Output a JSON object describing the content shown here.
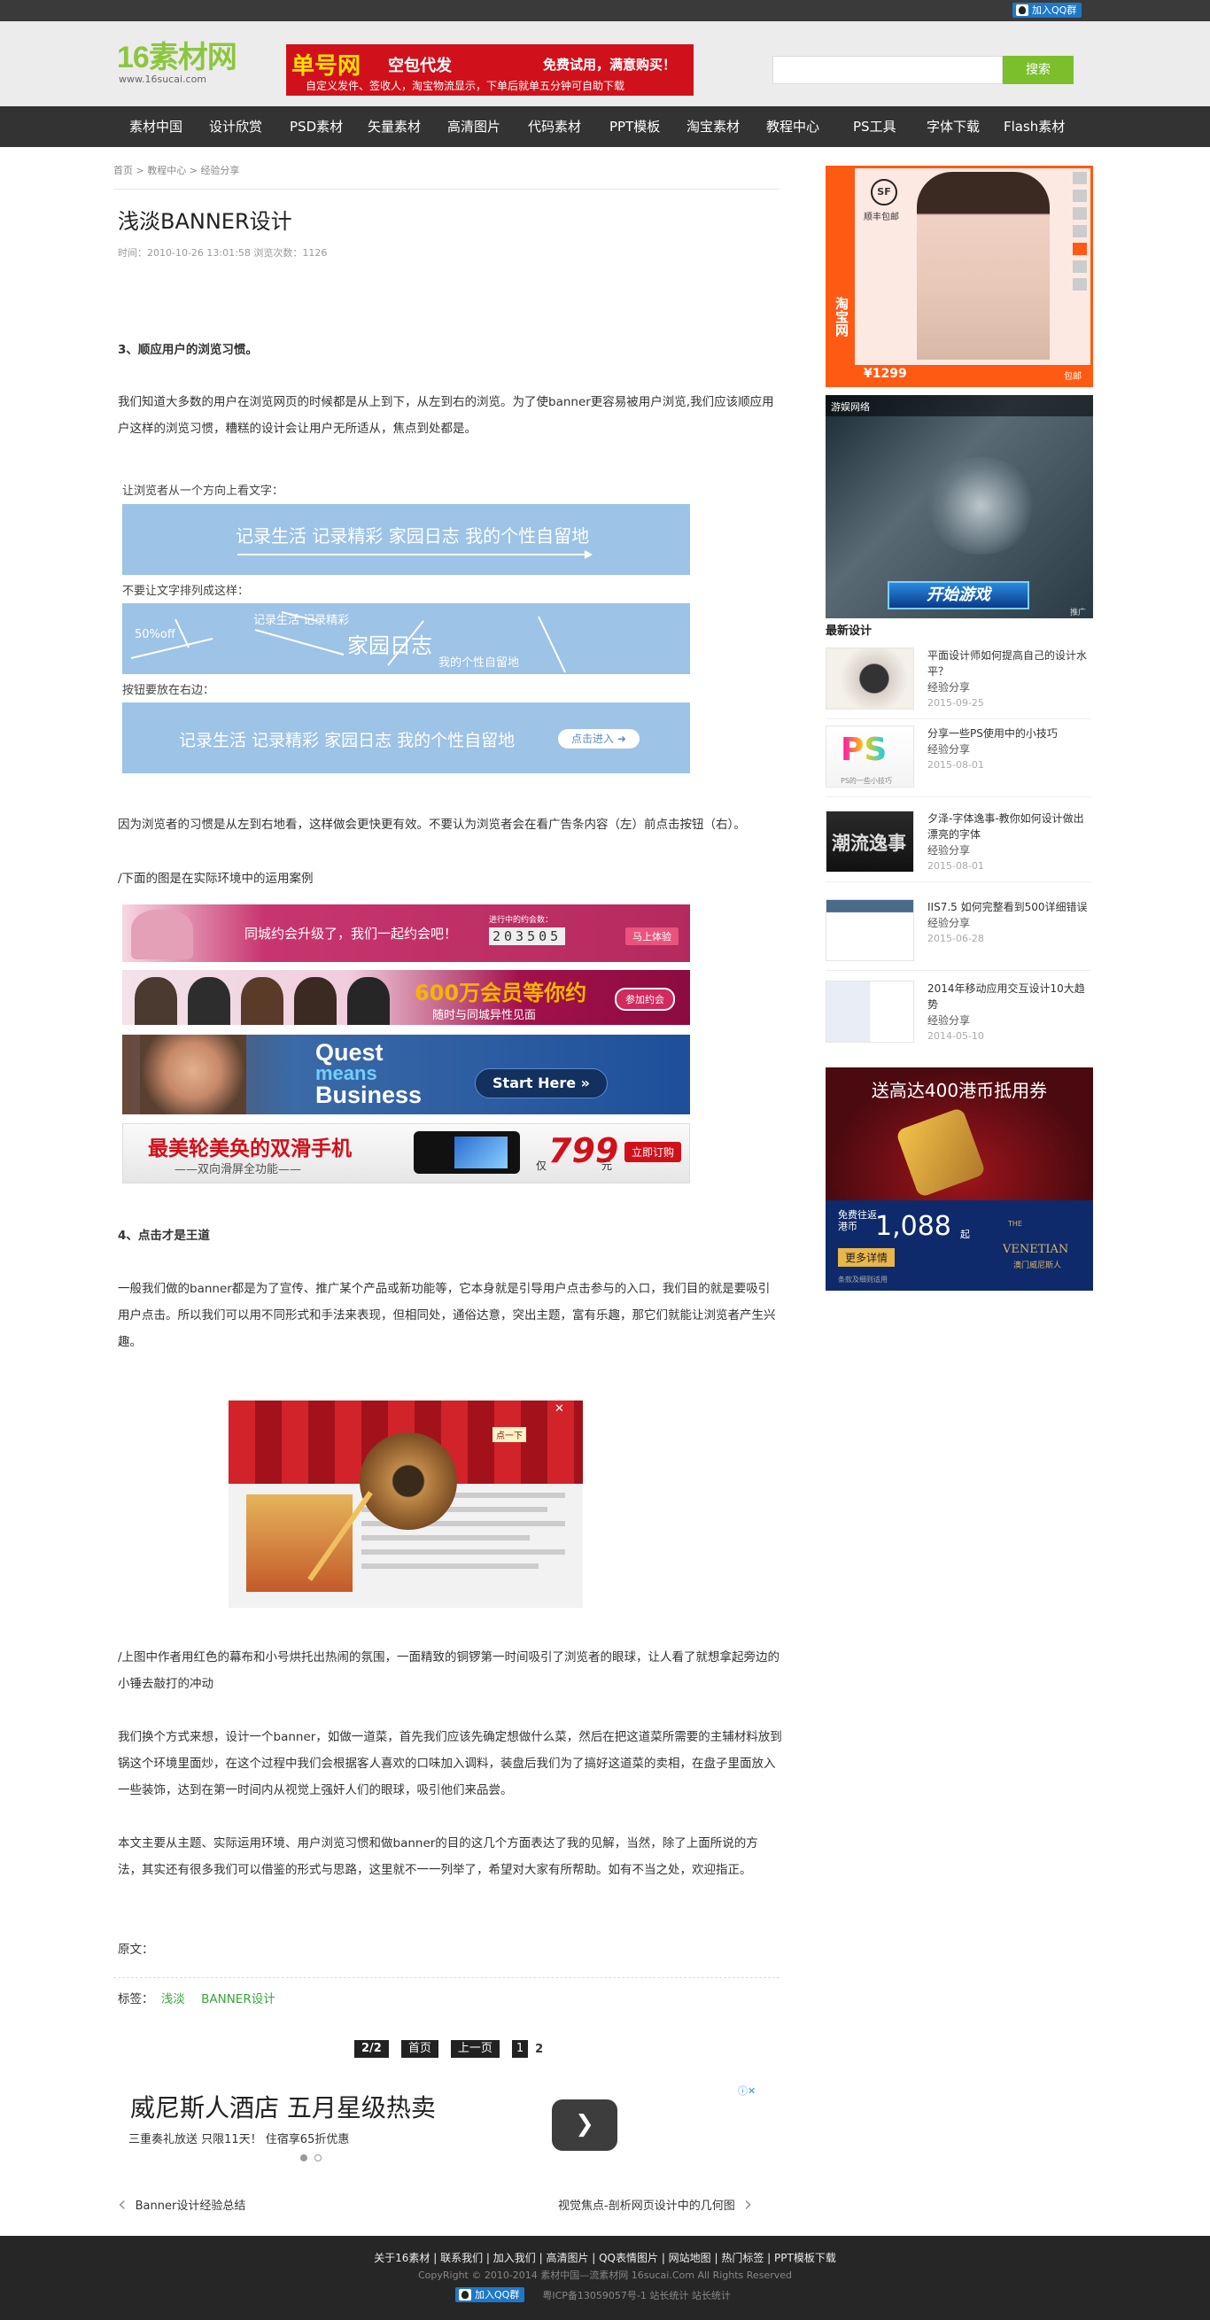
{
  "topbar": {
    "qq_label": "加入QQ群"
  },
  "header": {
    "logo_main": "16素材网",
    "logo_url": "www.16sucai.com",
    "ad_title": "单号网",
    "ad_slogan": "空包代发",
    "ad_offer": "免费试用，满意购买！",
    "ad_sub": "自定义发件、签收人，淘宝物流显示，下单后就单五分钟可自助下载",
    "search_placeholder": "",
    "search_button": "搜索"
  },
  "nav": [
    "素材中国",
    "设计欣赏",
    "PSD素材",
    "矢量素材",
    "高清图片",
    "代码素材",
    "PPT模板",
    "淘宝素材",
    "教程中心",
    "PS工具",
    "字体下载",
    "Flash素材"
  ],
  "breadcrumb": {
    "home": "首页",
    "sep": ">",
    "level1": "教程中心",
    "level2": "经验分享"
  },
  "article": {
    "title": "浅淡BANNER设计",
    "meta": "时间：2010-10-26 13:01:58 浏览次数：1126",
    "h3": "3、顺应用户的浏览习惯。",
    "p1": "我们知道大多数的用户在浏览网页的时候都是从上到下，从左到右的浏览。为了使banner更容易被用户浏览,我们应该顺应用户这样的浏览习惯，糟糕的设计会让用户无所适从，焦点到处都是。",
    "fig1_caption1": "让浏览者从一个方向上看文字：",
    "fig1_banner1": "记录生活 记录精彩 家园日志 我的个性自留地",
    "fig1_caption2": "不要让文字排列成这样：",
    "fig1_b2_a": "50%off",
    "fig1_b2_b": "记录生活 记录精彩",
    "fig1_b2_c": "家园日志",
    "fig1_b2_d": "我的个性自留地",
    "fig1_caption3": "按钮要放在右边：",
    "fig1_banner3": "记录生活 记录精彩 家园日志 我的个性自留地",
    "fig1_button": "点击进入",
    "p2": "因为浏览者的习惯是从左到右地看，这样做会更快更有效。不要认为浏览者会在看广告条内容（左）前点击按钮（右）。",
    "p3": "/下面的图是在实际环境中的运用案例",
    "ex1_text": "同城约会升级了，我们一起约会吧！",
    "ex1_counter_label": "进行中的约会数：",
    "ex1_counter": "203505",
    "ex1_btn": "马上体验",
    "ex2_text": "600万会员等你约",
    "ex2_sub": "随时与同城异性见面",
    "ex2_btn": "参加约会",
    "ex3_l1": "Quest",
    "ex3_l2": "means",
    "ex3_l3": "Business",
    "ex3_btn": "Start Here »",
    "ex4_text": "最美轮美奂的双滑手机",
    "ex4_sub": "——双向滑屏全功能——",
    "ex4_price_pre": "仅",
    "ex4_price": "799",
    "ex4_unit": "元",
    "ex4_btn": "立即订购",
    "h4": "4、点击才是王道",
    "p4": "一般我们做的banner都是为了宣传、推广某个产品或新功能等，它本身就是引导用户点击参与的入口，我们目的就是要吸引用户点击。所以我们可以用不同形式和手法来表现，但相同处，通俗达意，突出主题，富有乐趣，那它们就能让浏览者产生兴趣。",
    "fig2_tag": "点一下",
    "p5": "/上图中作者用红色的幕布和小号烘托出热闹的氛围，一面精致的铜锣第一时间吸引了浏览者的眼球，让人看了就想拿起旁边的小锤去敲打的冲动",
    "p6": "我们换个方式来想，设计一个banner，如做一道菜，首先我们应该先确定想做什么菜，然后在把这道菜所需要的主辅材料放到锅这个环境里面炒，在这个过程中我们会根据客人喜欢的口味加入调料，装盘后我们为了搞好这道菜的卖相，在盘子里面放入一些装饰，达到在第一时间内从视觉上强奸人们的眼球，吸引他们来品尝。",
    "p7": "本文主要从主题、实际运用环境、用户浏览习惯和做banner的目的这几个方面表达了我的见解，当然，除了上面所说的方法，其实还有很多我们可以借鉴的形式与思路，这里就不一一列举了，希望对大家有所帮助。如有不当之处，欢迎指正。",
    "source": "原文：",
    "tags_label": "标签：",
    "tags": [
      "浅淡",
      "BANNER设计"
    ]
  },
  "pagination": {
    "count": "2/2",
    "first": "首页",
    "prev": "上一页",
    "p1": "1",
    "p2": "2"
  },
  "bottom_ad": {
    "title": "威尼斯人酒店 五月星级热卖",
    "sub": "三重奏礼放送 只限11天！ 住宿享65折优惠",
    "badge": "ⓘ✕"
  },
  "prevnext": {
    "prev": "Banner设计经验总结",
    "next": "视觉焦点-剖析网页设计中的几何图"
  },
  "sidebar": {
    "ad1_brand": "淘宝网",
    "ad1_sf": "顺丰包邮",
    "ad1_price": "¥1299",
    "ad1_tag": "包邮",
    "ad2_brand": "游娱网络",
    "ad2_btn": "开始游戏",
    "ad2_badge": "推广",
    "latest_title": "最新设计",
    "items": [
      {
        "title": "平面设计师如何提高自己的设计水平？",
        "cat": "经验分享",
        "date": "2015-09-25"
      },
      {
        "title": "分享一些PS使用中的小技巧",
        "cat": "经验分享",
        "date": "2015-08-01"
      },
      {
        "title": "夕泽-字体逸事-教你如何设计做出漂亮的字体",
        "cat": "经验分享",
        "date": "2015-08-01"
      },
      {
        "title": "IIS7.5 如何完整看到500详细错误",
        "cat": "经验分享",
        "date": "2015-06-28"
      },
      {
        "title": "2014年移动应用交互设计10大趋势",
        "cat": "经验分享",
        "date": "2014-05-10"
      }
    ],
    "thumb2_caption": "PS的一些小技巧",
    "thumb3_text": "潮流逸事",
    "ad3_title": "送高达400港币抵用券",
    "ad3_l1": "免费往返",
    "ad3_l2": "港币",
    "ad3_amount": "1,088",
    "ad3_unit": "起",
    "ad3_btn": "更多详情",
    "ad3_logo": "VENETIAN",
    "ad3_the": "THE",
    "ad3_sub": "澳门威尼斯人",
    "ad3_fine": "条款及细则适用"
  },
  "footer": {
    "links": "关于16素材 | 联系我们 | 加入我们 | 高清图片 | QQ表情图片 | 网站地图 | 热门标签 | PPT模板下载",
    "copyright": "CopyRight © 2010-2014 素材中国—流素材网 16sucai.Com All Rights Reserved",
    "qq_label": "加入QQ群",
    "icp": "粤ICP备13059057号-1  站长统计 站长统计"
  }
}
